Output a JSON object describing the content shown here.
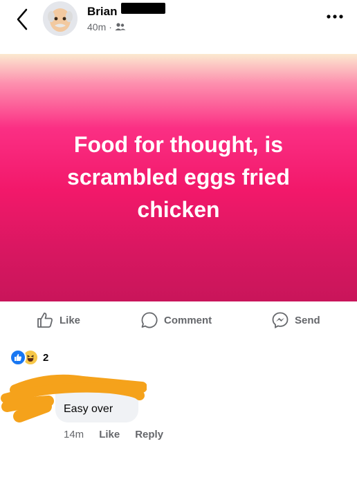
{
  "header": {
    "author_name": "Brian",
    "time_ago": "40m",
    "separator": "·",
    "audience_icon": "friends-icon",
    "back_icon": "chevron-left-icon",
    "more_icon": "more-horizontal-icon"
  },
  "post": {
    "text": "Food for thought, is scrambled eggs fried chicken",
    "background_colors": [
      "#fbe9d0",
      "#fb2f84",
      "#c9155a"
    ]
  },
  "actions": {
    "like_label": "Like",
    "comment_label": "Comment",
    "send_label": "Send"
  },
  "reactions": {
    "count": "2",
    "types": [
      "like",
      "haha"
    ]
  },
  "comment": {
    "text": "Easy over",
    "time_ago": "14m",
    "like_label": "Like",
    "reply_label": "Reply"
  },
  "colors": {
    "accent_blue": "#1877f2",
    "secondary_text": "#65676b",
    "redaction_orange": "#f5a21b"
  }
}
